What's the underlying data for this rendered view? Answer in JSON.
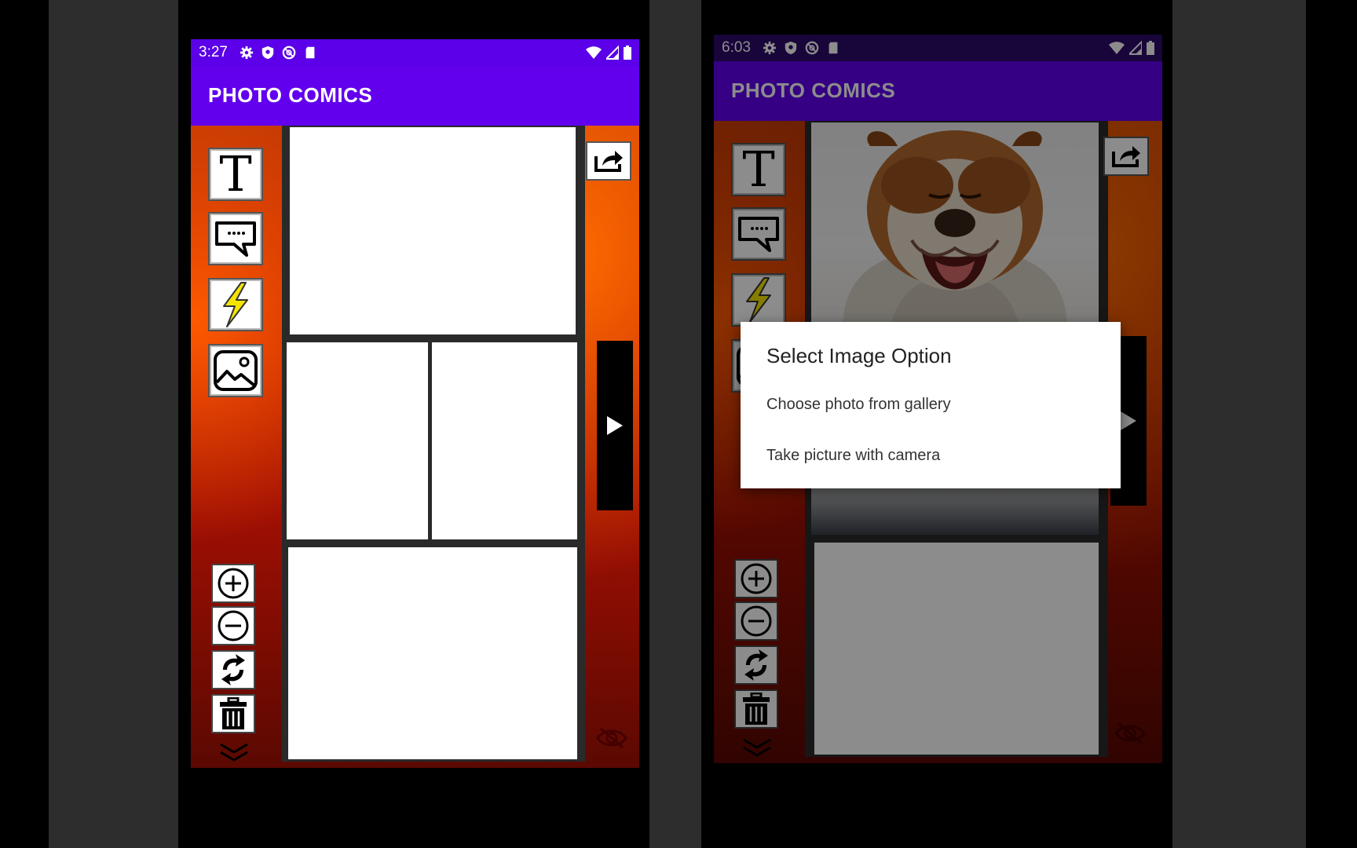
{
  "left_phone": {
    "status": {
      "time": "3:27"
    },
    "app_title": "PHOTO COMICS"
  },
  "right_phone": {
    "status": {
      "time": "6:03"
    },
    "app_title": "PHOTO COMICS",
    "dialog": {
      "title": "Select Image Option",
      "options": [
        "Choose photo from gallery",
        "Take picture with camera"
      ]
    }
  },
  "tools": {
    "text_glyph": "T",
    "icons": [
      "text-icon",
      "speech-bubble-icon",
      "lightning-icon",
      "image-icon",
      "zoom-in-icon",
      "zoom-out-icon",
      "rotate-icon",
      "trash-icon",
      "chevron-down-icon",
      "share-icon",
      "play-icon",
      "hide-icon"
    ]
  },
  "colors": {
    "status_bar": "#5b00e8",
    "app_bar": "#6200ee",
    "background_gradient": [
      "#ff6a00",
      "#b71d04",
      "#5a0902"
    ]
  }
}
